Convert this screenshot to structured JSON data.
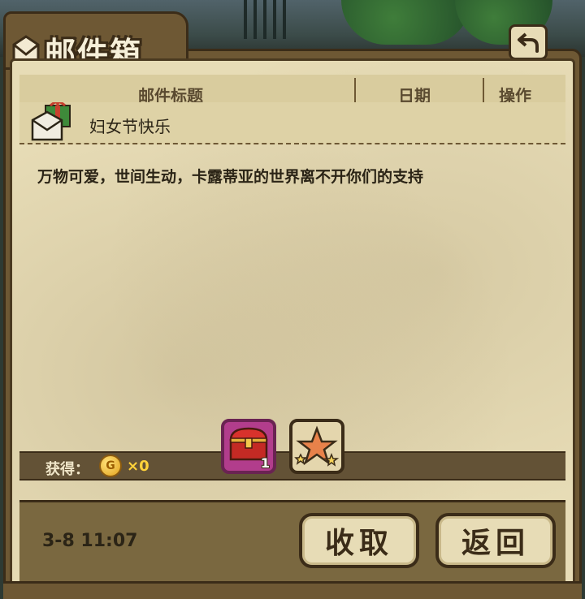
{
  "window": {
    "title": "邮件箱",
    "back_icon": "return-arrow-icon"
  },
  "table": {
    "columns": [
      "邮件标题",
      "日期",
      "操作"
    ]
  },
  "mail": {
    "title": "妇女节快乐",
    "icon": "gift-envelope-icon",
    "body": "万物可爱，世间生动，卡露蒂亚的世界离不开你们的支持"
  },
  "rewards": {
    "label": "获得：",
    "coin_icon": "G",
    "coin_count": "×0",
    "items": [
      {
        "icon": "treasure-chest-icon",
        "count": "1",
        "border_color": "#b23d8c"
      },
      {
        "icon": "star-icon",
        "count": "",
        "border_color": "#3b2c18"
      }
    ]
  },
  "footer": {
    "timestamp": "3-8 11:07",
    "collect_label": "收取",
    "return_label": "返回"
  }
}
